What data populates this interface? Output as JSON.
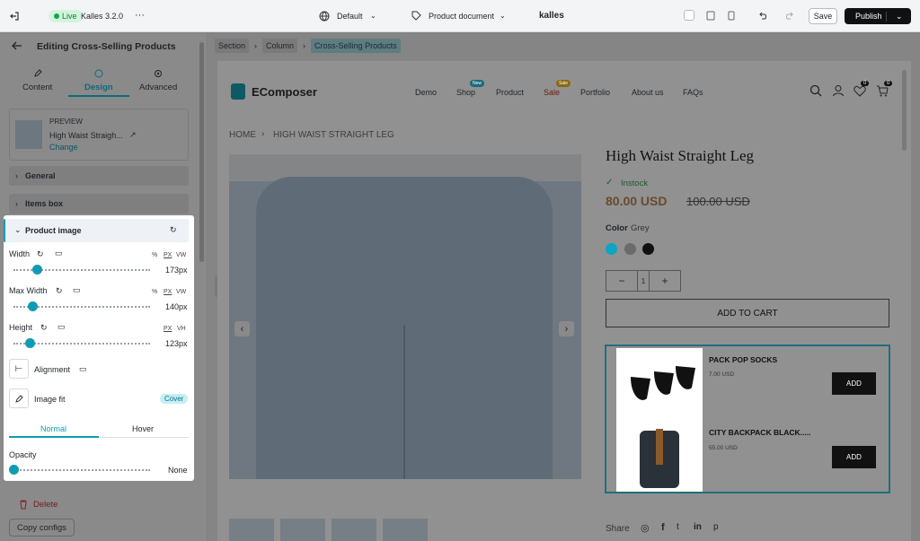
{
  "topbar": {
    "live": "Live",
    "theme": "Kalles 3.2.0",
    "layout": "Default",
    "doc_type": "Product document",
    "store": "kalles",
    "save": "Save",
    "publish": "Publish"
  },
  "sidebar": {
    "title": "Editing Cross-Selling Products",
    "tabs": [
      "Content",
      "Design",
      "Advanced"
    ],
    "preview": {
      "label": "PREVIEW",
      "product": "High Waist Straigh...",
      "change": "Change"
    },
    "sections": [
      "General",
      "Items box"
    ],
    "product_image": {
      "title": "Product image",
      "width": {
        "label": "Width",
        "units": [
          "%",
          "PX",
          "VW"
        ],
        "value": "173px",
        "level": 0.17
      },
      "max_width": {
        "label": "Max Width",
        "units": [
          "%",
          "PX",
          "VW"
        ],
        "value": "140px",
        "level": 0.14
      },
      "height": {
        "label": "Height",
        "units": [
          "PX",
          "VH"
        ],
        "value": "123px",
        "level": 0.12
      },
      "alignment": "Alignment",
      "image_fit": "Image fit",
      "image_fit_value": "Cover",
      "state_tabs": [
        "Normal",
        "Hover"
      ],
      "opacity": {
        "label": "Opacity",
        "value": "None",
        "level": 0
      }
    },
    "delete": "Delete",
    "copy": "Copy configs"
  },
  "breadcrumb": [
    "Section",
    "Column",
    "Cross-Selling Products"
  ],
  "store": {
    "logo": "EComposer",
    "nav": [
      "Demo",
      "Shop",
      "Product",
      "Sale",
      "Portfolio",
      "About us",
      "FAQs"
    ],
    "badges": {
      "new": "New",
      "sale": "Sale"
    },
    "wishlist_count": "0",
    "cart_count": "0",
    "crumbs": [
      "HOME",
      "HIGH WAIST STRAIGHT LEG"
    ]
  },
  "product": {
    "title": "High Waist Straight Leg",
    "stock": "Instock",
    "price": "80.00 USD",
    "old_price": "100.00 USD",
    "color_label": "Color",
    "color_value": "Grey",
    "swatches": [
      "#0fa4c4",
      "#6b6b6b",
      "#111111"
    ],
    "qty": "1",
    "add_to_cart": "ADD TO CART",
    "share": "Share"
  },
  "cross_sell": [
    {
      "name": "PACK POP SOCKS",
      "price": "7.00 USD",
      "button": "ADD"
    },
    {
      "name": "CITY BACKPACK BLACK.....",
      "price": "55.00 USD",
      "button": "ADD"
    }
  ]
}
